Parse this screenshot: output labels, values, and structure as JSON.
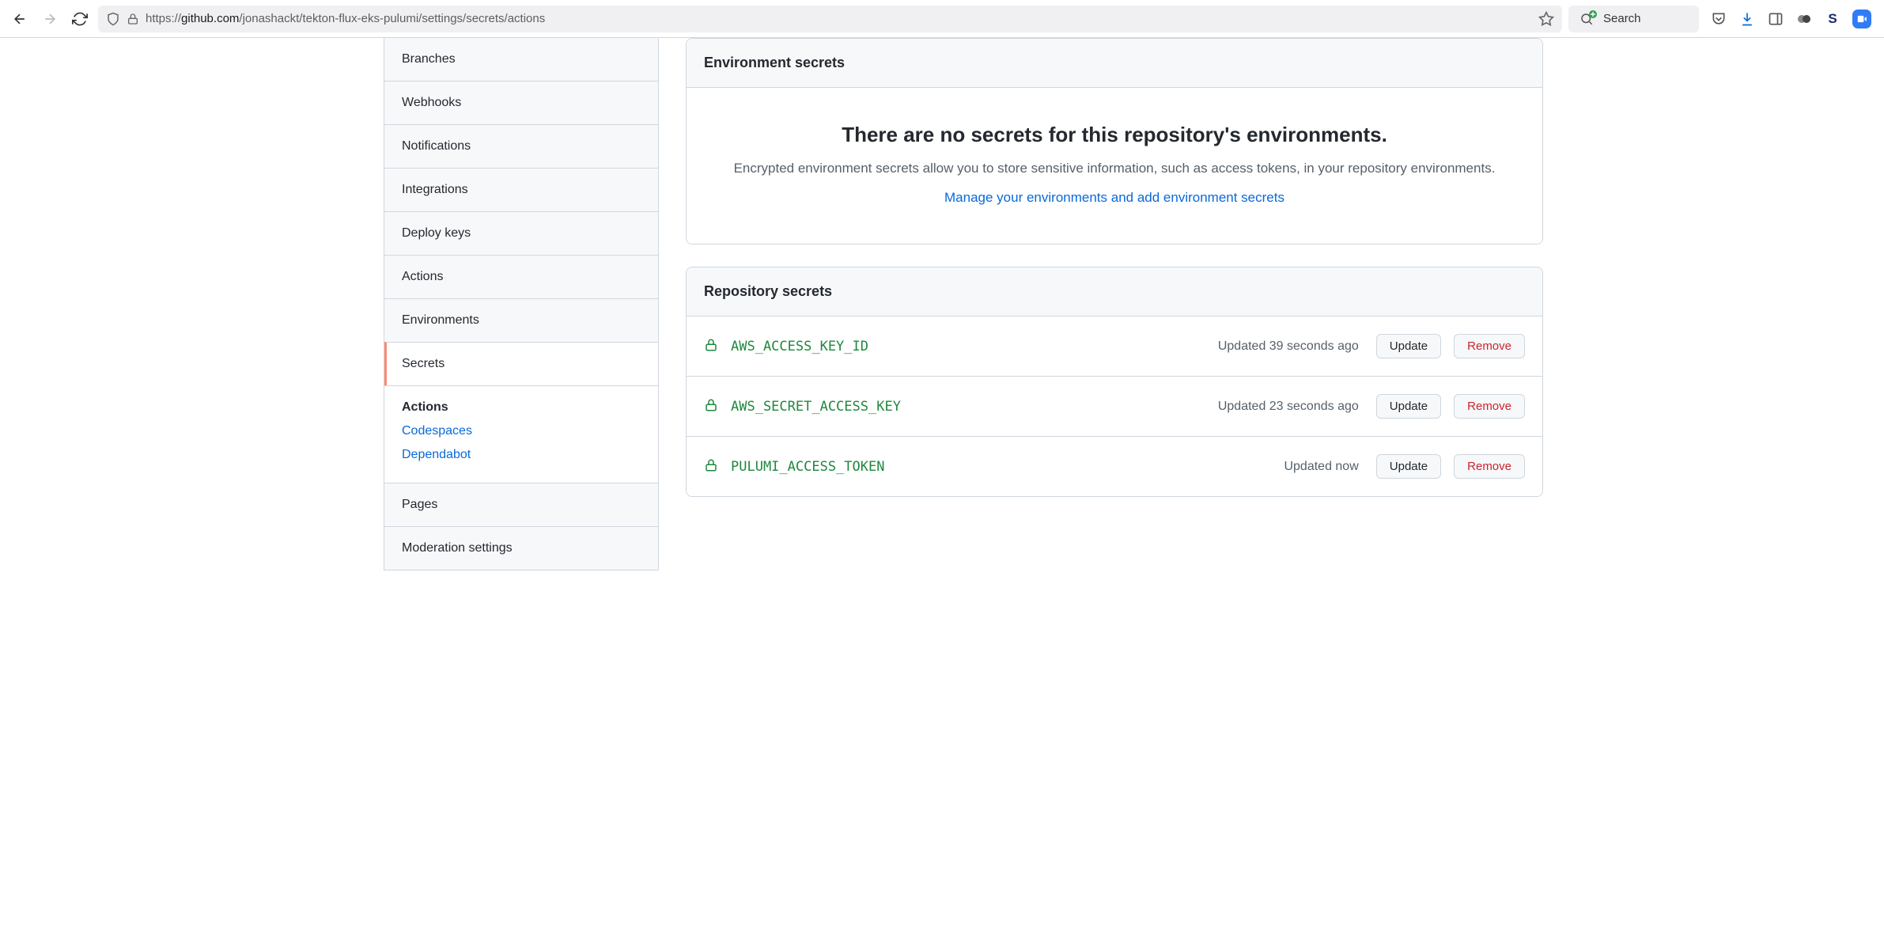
{
  "browser": {
    "url_prefix": "https://",
    "url_domain": "github.com",
    "url_path": "/jonashackt/tekton-flux-eks-pulumi/settings/secrets/actions",
    "search_placeholder": "Search"
  },
  "sidebar": {
    "items": [
      {
        "label": "Branches"
      },
      {
        "label": "Webhooks"
      },
      {
        "label": "Notifications"
      },
      {
        "label": "Integrations"
      },
      {
        "label": "Deploy keys"
      },
      {
        "label": "Actions"
      },
      {
        "label": "Environments"
      },
      {
        "label": "Secrets"
      },
      {
        "label": "Pages"
      },
      {
        "label": "Moderation settings"
      }
    ],
    "sub": {
      "heading": "Actions",
      "links": [
        {
          "label": "Codespaces"
        },
        {
          "label": "Dependabot"
        }
      ]
    }
  },
  "env_panel": {
    "title": "Environment secrets",
    "headline": "There are no secrets for this repository's environments.",
    "description": "Encrypted environment secrets allow you to store sensitive information, such as access tokens, in your repository environments.",
    "link": "Manage your environments and add environment secrets"
  },
  "repo_panel": {
    "title": "Repository secrets",
    "update_label": "Update",
    "remove_label": "Remove",
    "secrets": [
      {
        "name": "AWS_ACCESS_KEY_ID",
        "updated": "Updated 39 seconds ago"
      },
      {
        "name": "AWS_SECRET_ACCESS_KEY",
        "updated": "Updated 23 seconds ago"
      },
      {
        "name": "PULUMI_ACCESS_TOKEN",
        "updated": "Updated now"
      }
    ]
  }
}
